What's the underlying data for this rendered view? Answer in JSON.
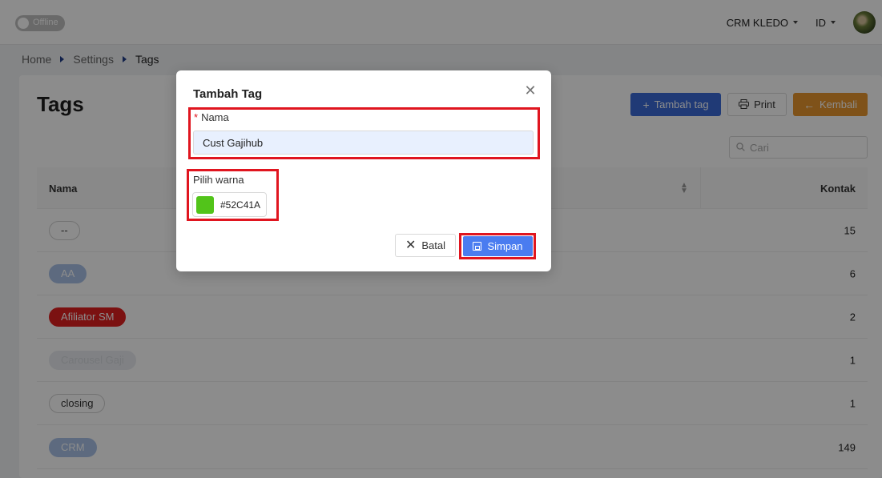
{
  "topbar": {
    "status_label": "Offline",
    "company": "CRM KLEDO",
    "language": "ID"
  },
  "breadcrumb": [
    "Home",
    "Settings",
    "Tags"
  ],
  "page": {
    "title": "Tags",
    "add_button": "Tambah tag",
    "print_button": "Print",
    "back_button": "Kembali",
    "search_placeholder": "Cari"
  },
  "table": {
    "columns": [
      "Nama",
      "Kontak"
    ],
    "rows": [
      {
        "tag": "--",
        "tag_bg": "#ffffff",
        "tag_fg": "#333333",
        "tag_border": "#d0d0d0",
        "count": "15"
      },
      {
        "tag": "AA",
        "tag_bg": "#a9c2e8",
        "tag_fg": "#ffffff",
        "tag_border": "#a9c2e8",
        "count": "6"
      },
      {
        "tag": "Afiliator SM",
        "tag_bg": "#e02020",
        "tag_fg": "#ffffff",
        "tag_border": "#e02020",
        "count": "2"
      },
      {
        "tag": "Carousel Gaji",
        "tag_bg": "#e9ecf0",
        "tag_fg": "#d5d9de",
        "tag_border": "#e9ecf0",
        "count": "1"
      },
      {
        "tag": "closing",
        "tag_bg": "#ffffff",
        "tag_fg": "#333333",
        "tag_border": "#d0d0d0",
        "count": "1"
      },
      {
        "tag": "CRM",
        "tag_bg": "#a9c2e8",
        "tag_fg": "#ffffff",
        "tag_border": "#a9c2e8",
        "count": "149"
      }
    ]
  },
  "modal": {
    "title": "Tambah Tag",
    "name_label": "Nama",
    "name_required_mark": "*",
    "name_value": "Cust Gajihub",
    "color_label": "Pilih warna",
    "color_value": "#52C41A",
    "cancel_button": "Batal",
    "save_button": "Simpan"
  },
  "colors": {
    "primary": "#3b6bd8",
    "warning": "#e8962e",
    "highlight": "#e0151f",
    "save_button": "#4a7cf0"
  }
}
